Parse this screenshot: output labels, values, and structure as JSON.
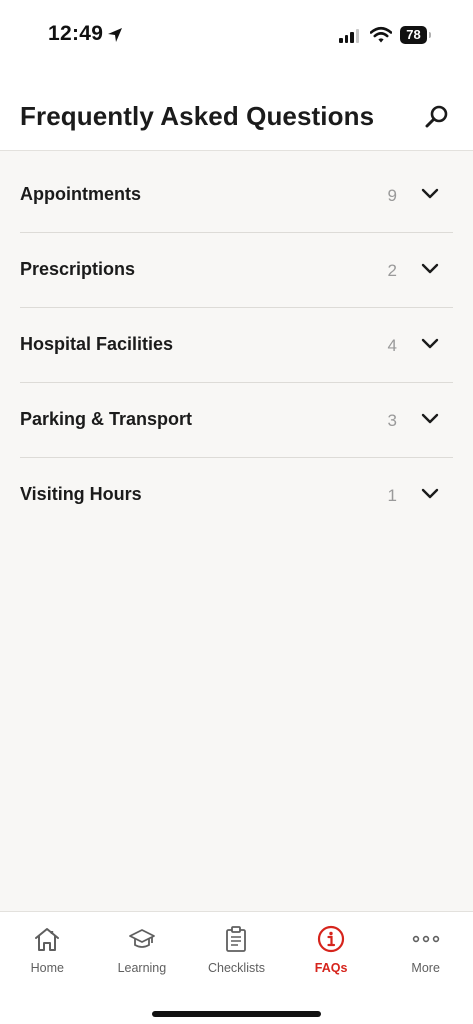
{
  "status_bar": {
    "time": "12:49",
    "battery": "78",
    "icons": [
      "location-arrow-icon",
      "signal-icon",
      "wifi-icon",
      "battery-icon"
    ]
  },
  "header": {
    "title": "Frequently Asked Questions",
    "search_icon": "search-icon"
  },
  "faq_categories": [
    {
      "label": "Appointments",
      "count": "9"
    },
    {
      "label": "Prescriptions",
      "count": "2"
    },
    {
      "label": "Hospital Facilities",
      "count": "4"
    },
    {
      "label": "Parking & Transport",
      "count": "3"
    },
    {
      "label": "Visiting Hours",
      "count": "1"
    }
  ],
  "tab_bar": {
    "tabs": [
      {
        "label": "Home",
        "icon": "home-icon"
      },
      {
        "label": "Learning",
        "icon": "graduation-cap-icon"
      },
      {
        "label": "Checklists",
        "icon": "clipboard-icon"
      },
      {
        "label": "FAQs",
        "icon": "info-icon",
        "active": true
      },
      {
        "label": "More",
        "icon": "more-icon"
      }
    ]
  },
  "colors": {
    "accent": "#d6241c",
    "background": "#f8f7f5",
    "text": "#1b1b1b",
    "count": "#9a9a9a"
  }
}
